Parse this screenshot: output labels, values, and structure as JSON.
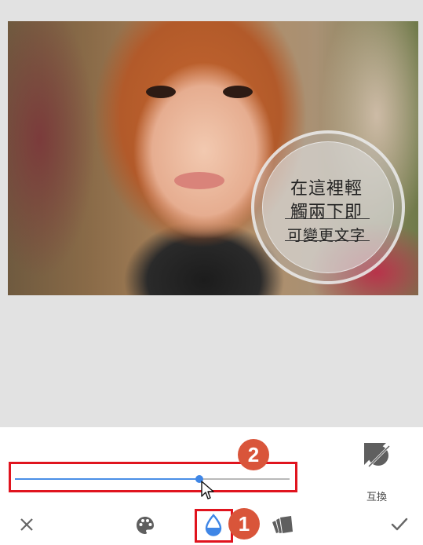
{
  "photo": {
    "badge": {
      "line1": "在這裡輕",
      "line2": "觸兩下即",
      "line3": "可變更文字"
    }
  },
  "tools": {
    "swap_label": "互換",
    "swap_icon": "no-icon-symbol",
    "close_icon": "close-icon",
    "palette_icon": "palette-icon",
    "drop_icon": "opacity-drop-icon",
    "cards_icon": "style-cards-icon",
    "check_icon": "check-icon"
  },
  "slider": {
    "value": 0.67,
    "accent_color": "#4a8fe7"
  },
  "annotations": {
    "step1": "1",
    "step2": "2",
    "highlight_color": "#e0141e",
    "badge_color": "#d9553a"
  }
}
